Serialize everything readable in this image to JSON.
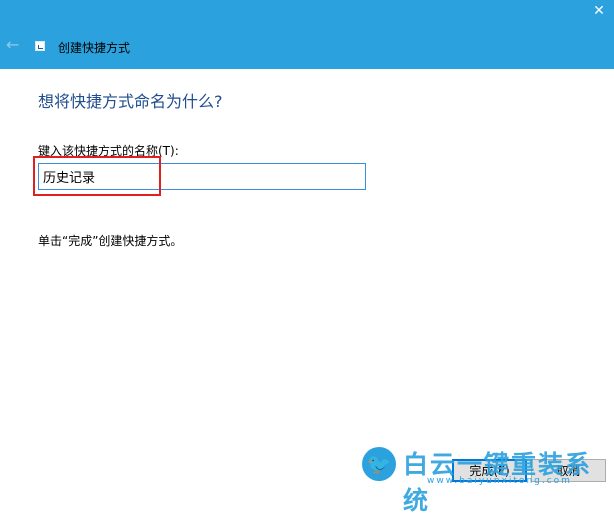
{
  "window": {
    "title": "创建快捷方式",
    "close_glyph": "✕",
    "back_glyph": "←"
  },
  "main": {
    "heading": "想将快捷方式命名为什么?",
    "field_label": "键入该快捷方式的名称(T):",
    "name_value": "历史记录",
    "hint": "单击“完成”创建快捷方式。"
  },
  "buttons": {
    "finish_label": "完成(F)",
    "cancel_label": "取消"
  },
  "watermark": {
    "bird_glyph": "🐦",
    "text": "白云一键重装系统",
    "url": "www.baiyunxitong.com"
  },
  "colors": {
    "titlebar": "#2ba1de",
    "heading": "#1f4d8f",
    "highlight": "#e02020",
    "input_border": "#3b8fd6"
  }
}
